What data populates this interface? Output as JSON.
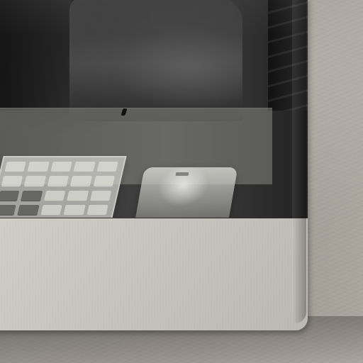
{
  "image": {
    "type": "photo",
    "subject": "monitor-close-up",
    "palette": {
      "wall": "#9a958e",
      "monitor": "#d6d4cf",
      "screen": "#060606",
      "overlay": "#848480"
    }
  }
}
